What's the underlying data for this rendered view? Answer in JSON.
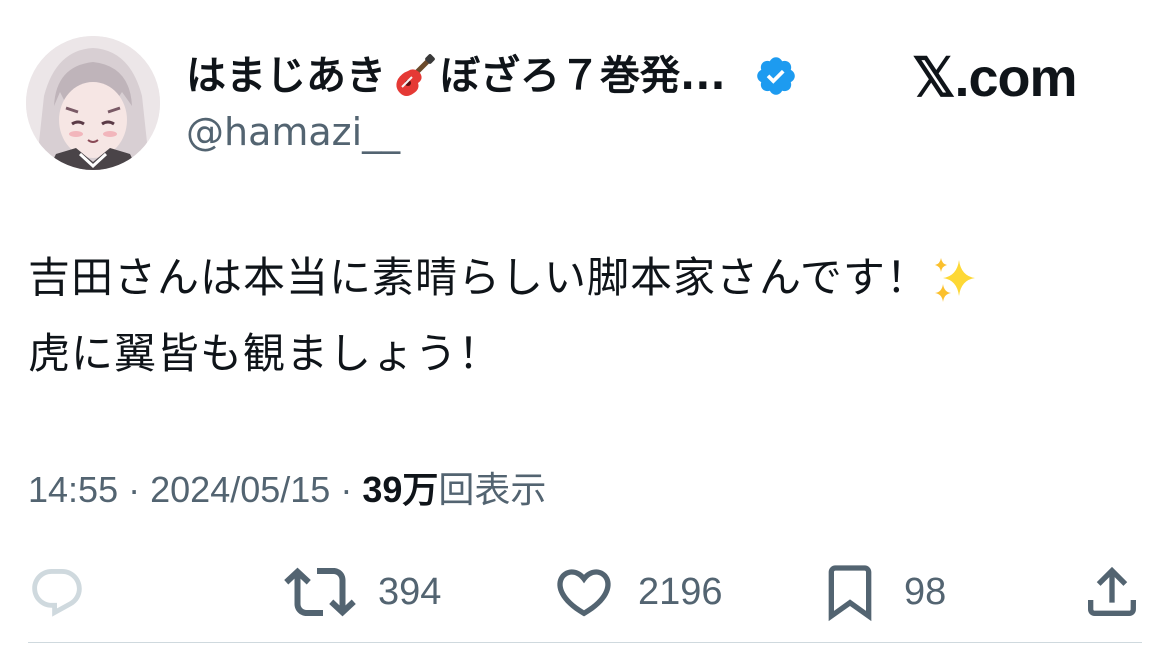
{
  "user": {
    "display_name_prefix": "はまじあき",
    "display_name_suffix": "ぼざろ７巻発...",
    "handle": "@hamazi__",
    "verified": true,
    "avatar_icon": "anime-girl-avatar"
  },
  "site_logo": "𝕏.com",
  "tweet": {
    "line1": "吉田さんは本当に素晴らしい脚本家さんです！",
    "line2": "虎に翼皆も観ましょう！"
  },
  "meta": {
    "time": "14:55",
    "separator": "·",
    "date": "2024/05/15",
    "views_count": "39万",
    "views_label": "回表示"
  },
  "actions": {
    "reply_count": "",
    "retweet_count": "394",
    "like_count": "2196",
    "bookmark_count": "98"
  },
  "colors": {
    "text": "#0f1419",
    "secondary": "#536471",
    "verified_blue": "#1d9bf0",
    "sparkle": "#fdd835"
  }
}
